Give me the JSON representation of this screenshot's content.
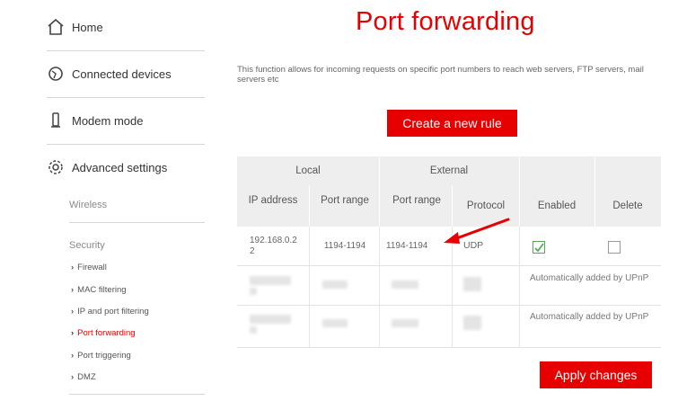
{
  "sidebar": {
    "items": [
      {
        "label": "Home",
        "icon": "home-icon"
      },
      {
        "label": "Connected devices",
        "icon": "devices-icon"
      },
      {
        "label": "Modem mode",
        "icon": "modem-icon"
      },
      {
        "label": "Advanced settings",
        "icon": "gear-icon"
      }
    ],
    "wireless": "Wireless",
    "security": "Security",
    "security_links": [
      {
        "label": "Firewall"
      },
      {
        "label": "MAC filtering"
      },
      {
        "label": "IP and port filtering"
      },
      {
        "label": "Port forwarding",
        "active": true
      },
      {
        "label": "Port triggering"
      },
      {
        "label": "DMZ"
      }
    ]
  },
  "main": {
    "title": "Port forwarding",
    "description": "This function allows for incoming requests on specific port numbers to reach web servers, FTP servers, mail servers etc",
    "create_label": "Create a new rule",
    "apply_label": "Apply changes"
  },
  "table": {
    "group_local": "Local",
    "group_external": "External",
    "col_ip": "IP address",
    "col_local_range": "Port range",
    "col_ext_range": "Port range",
    "col_protocol": "Protocol",
    "col_enabled": "Enabled",
    "col_delete": "Delete",
    "rows": [
      {
        "ip": "192.168.0.22",
        "local_range": "1194-1194",
        "ext_range": "1194-1194",
        "protocol": "UDP",
        "enabled": true
      },
      {
        "note": "Automatically added by UPnP"
      },
      {
        "note": "Automatically added by UPnP"
      }
    ]
  },
  "colors": {
    "accent": "#e60000",
    "header_bg": "#eeeeee",
    "check": "#4caf50"
  }
}
